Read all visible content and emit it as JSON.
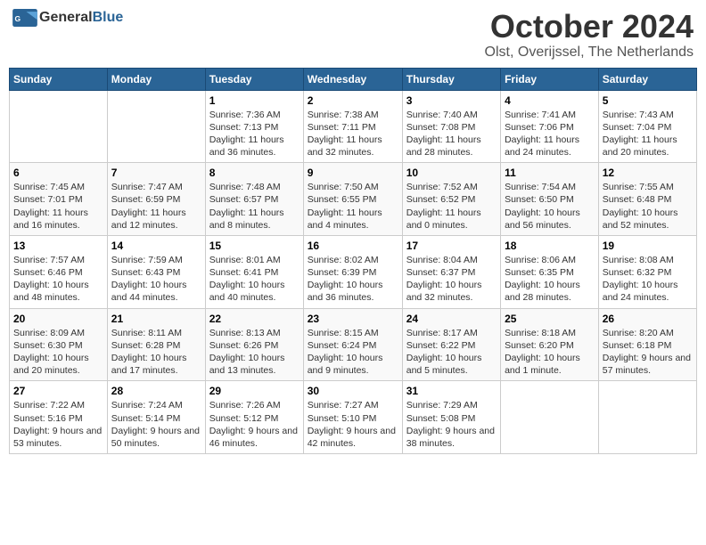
{
  "header": {
    "logo_general": "General",
    "logo_blue": "Blue",
    "month": "October 2024",
    "location": "Olst, Overijssel, The Netherlands"
  },
  "days_of_week": [
    "Sunday",
    "Monday",
    "Tuesday",
    "Wednesday",
    "Thursday",
    "Friday",
    "Saturday"
  ],
  "weeks": [
    [
      {
        "day": "",
        "info": ""
      },
      {
        "day": "",
        "info": ""
      },
      {
        "day": "1",
        "info": "Sunrise: 7:36 AM\nSunset: 7:13 PM\nDaylight: 11 hours and 36 minutes."
      },
      {
        "day": "2",
        "info": "Sunrise: 7:38 AM\nSunset: 7:11 PM\nDaylight: 11 hours and 32 minutes."
      },
      {
        "day": "3",
        "info": "Sunrise: 7:40 AM\nSunset: 7:08 PM\nDaylight: 11 hours and 28 minutes."
      },
      {
        "day": "4",
        "info": "Sunrise: 7:41 AM\nSunset: 7:06 PM\nDaylight: 11 hours and 24 minutes."
      },
      {
        "day": "5",
        "info": "Sunrise: 7:43 AM\nSunset: 7:04 PM\nDaylight: 11 hours and 20 minutes."
      }
    ],
    [
      {
        "day": "6",
        "info": "Sunrise: 7:45 AM\nSunset: 7:01 PM\nDaylight: 11 hours and 16 minutes."
      },
      {
        "day": "7",
        "info": "Sunrise: 7:47 AM\nSunset: 6:59 PM\nDaylight: 11 hours and 12 minutes."
      },
      {
        "day": "8",
        "info": "Sunrise: 7:48 AM\nSunset: 6:57 PM\nDaylight: 11 hours and 8 minutes."
      },
      {
        "day": "9",
        "info": "Sunrise: 7:50 AM\nSunset: 6:55 PM\nDaylight: 11 hours and 4 minutes."
      },
      {
        "day": "10",
        "info": "Sunrise: 7:52 AM\nSunset: 6:52 PM\nDaylight: 11 hours and 0 minutes."
      },
      {
        "day": "11",
        "info": "Sunrise: 7:54 AM\nSunset: 6:50 PM\nDaylight: 10 hours and 56 minutes."
      },
      {
        "day": "12",
        "info": "Sunrise: 7:55 AM\nSunset: 6:48 PM\nDaylight: 10 hours and 52 minutes."
      }
    ],
    [
      {
        "day": "13",
        "info": "Sunrise: 7:57 AM\nSunset: 6:46 PM\nDaylight: 10 hours and 48 minutes."
      },
      {
        "day": "14",
        "info": "Sunrise: 7:59 AM\nSunset: 6:43 PM\nDaylight: 10 hours and 44 minutes."
      },
      {
        "day": "15",
        "info": "Sunrise: 8:01 AM\nSunset: 6:41 PM\nDaylight: 10 hours and 40 minutes."
      },
      {
        "day": "16",
        "info": "Sunrise: 8:02 AM\nSunset: 6:39 PM\nDaylight: 10 hours and 36 minutes."
      },
      {
        "day": "17",
        "info": "Sunrise: 8:04 AM\nSunset: 6:37 PM\nDaylight: 10 hours and 32 minutes."
      },
      {
        "day": "18",
        "info": "Sunrise: 8:06 AM\nSunset: 6:35 PM\nDaylight: 10 hours and 28 minutes."
      },
      {
        "day": "19",
        "info": "Sunrise: 8:08 AM\nSunset: 6:32 PM\nDaylight: 10 hours and 24 minutes."
      }
    ],
    [
      {
        "day": "20",
        "info": "Sunrise: 8:09 AM\nSunset: 6:30 PM\nDaylight: 10 hours and 20 minutes."
      },
      {
        "day": "21",
        "info": "Sunrise: 8:11 AM\nSunset: 6:28 PM\nDaylight: 10 hours and 17 minutes."
      },
      {
        "day": "22",
        "info": "Sunrise: 8:13 AM\nSunset: 6:26 PM\nDaylight: 10 hours and 13 minutes."
      },
      {
        "day": "23",
        "info": "Sunrise: 8:15 AM\nSunset: 6:24 PM\nDaylight: 10 hours and 9 minutes."
      },
      {
        "day": "24",
        "info": "Sunrise: 8:17 AM\nSunset: 6:22 PM\nDaylight: 10 hours and 5 minutes."
      },
      {
        "day": "25",
        "info": "Sunrise: 8:18 AM\nSunset: 6:20 PM\nDaylight: 10 hours and 1 minute."
      },
      {
        "day": "26",
        "info": "Sunrise: 8:20 AM\nSunset: 6:18 PM\nDaylight: 9 hours and 57 minutes."
      }
    ],
    [
      {
        "day": "27",
        "info": "Sunrise: 7:22 AM\nSunset: 5:16 PM\nDaylight: 9 hours and 53 minutes."
      },
      {
        "day": "28",
        "info": "Sunrise: 7:24 AM\nSunset: 5:14 PM\nDaylight: 9 hours and 50 minutes."
      },
      {
        "day": "29",
        "info": "Sunrise: 7:26 AM\nSunset: 5:12 PM\nDaylight: 9 hours and 46 minutes."
      },
      {
        "day": "30",
        "info": "Sunrise: 7:27 AM\nSunset: 5:10 PM\nDaylight: 9 hours and 42 minutes."
      },
      {
        "day": "31",
        "info": "Sunrise: 7:29 AM\nSunset: 5:08 PM\nDaylight: 9 hours and 38 minutes."
      },
      {
        "day": "",
        "info": ""
      },
      {
        "day": "",
        "info": ""
      }
    ]
  ]
}
